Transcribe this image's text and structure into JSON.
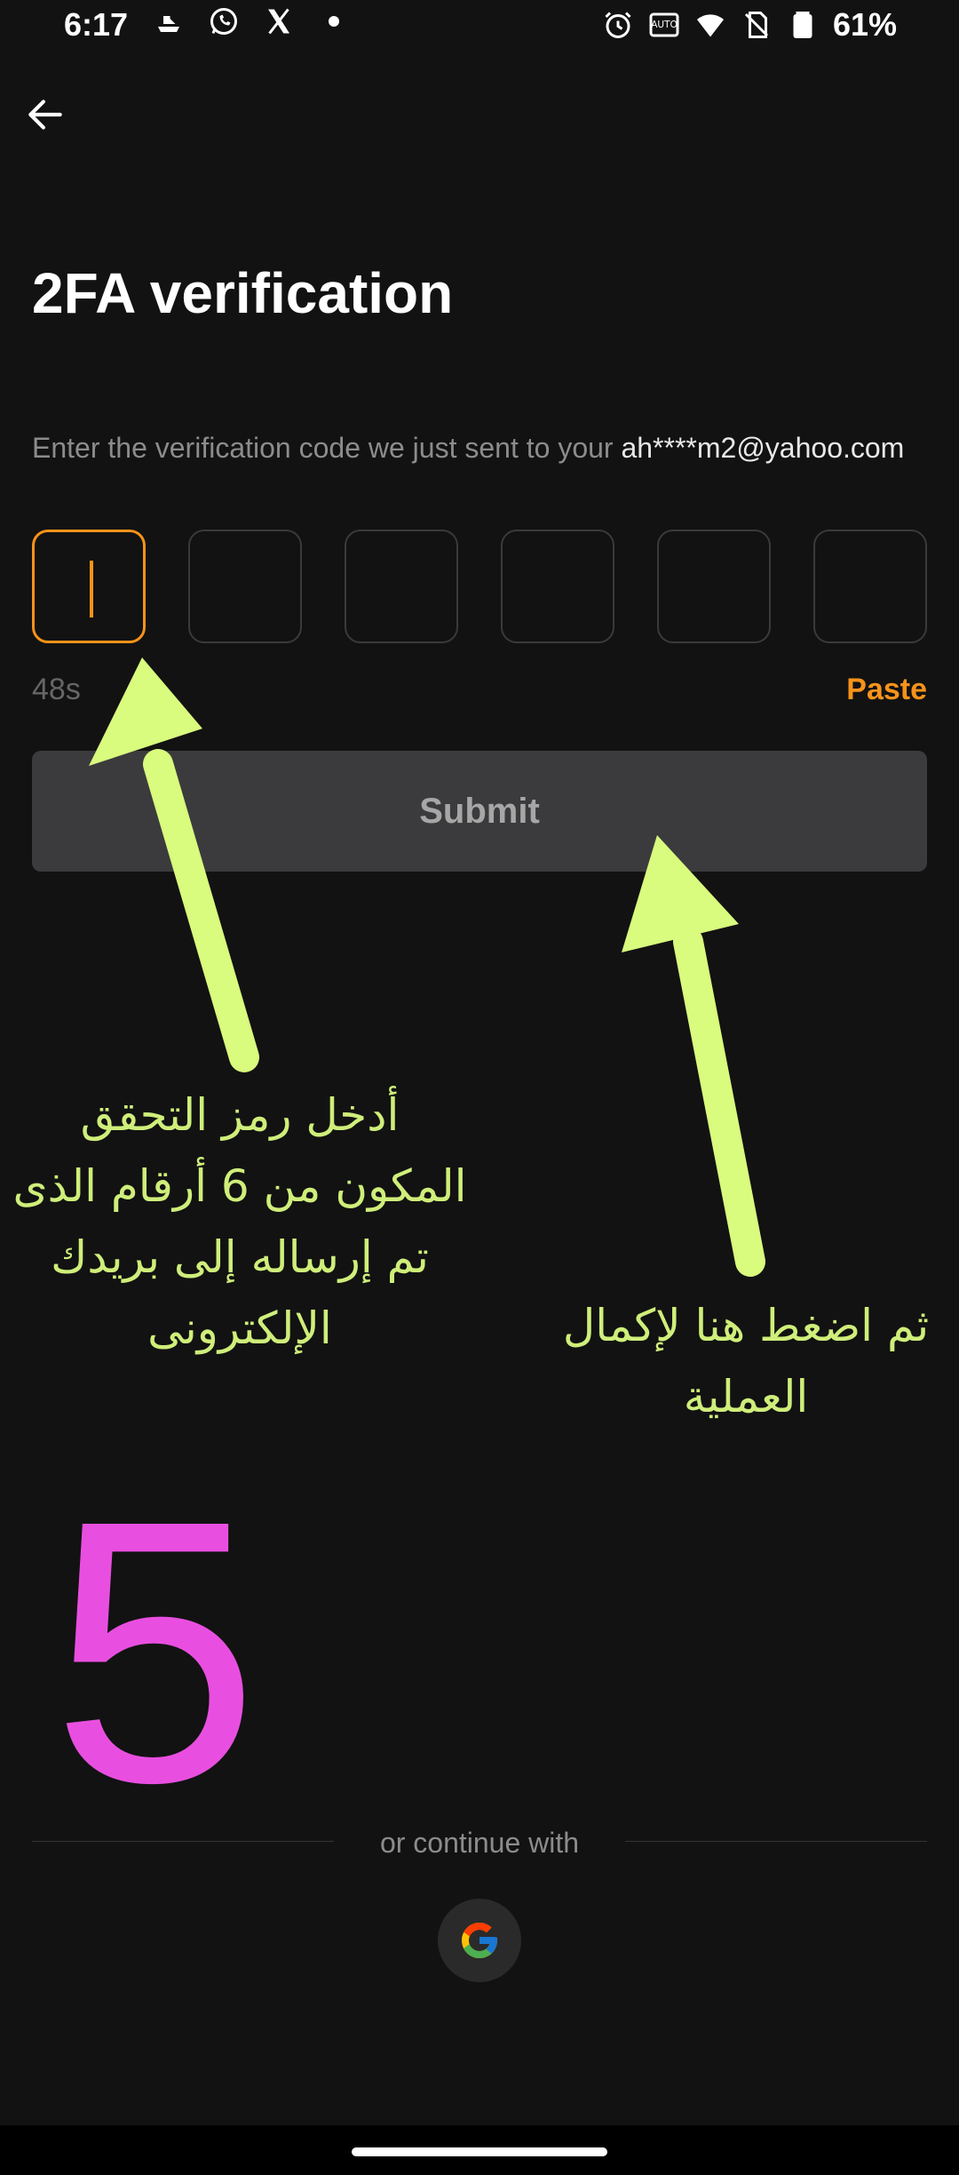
{
  "status_bar": {
    "time": "6:17",
    "battery": "61%",
    "left_icons": [
      "boat-icon",
      "whatsapp-icon",
      "x-icon",
      "dot-icon"
    ],
    "right_icons": [
      "alarm-icon",
      "auto-hz-icon",
      "wifi-6-icon",
      "no-sim-icon",
      "battery-icon"
    ]
  },
  "header": {
    "back_icon": "arrow-left-icon",
    "title": "2FA verification"
  },
  "verification": {
    "instruction_prefix": "Enter the verification code we just sent to your ",
    "email": "ah****m2@yahoo.com",
    "code_length": 6,
    "code_values": [
      "",
      "",
      "",
      "",
      "",
      ""
    ],
    "timer": "48s",
    "paste_label": "Paste",
    "submit_label": "Submit"
  },
  "annotations": {
    "left_text": "أدخل رمز التحقق\nالمكون من 6 أرقام الذى\nتم إرساله إلى بريدك\nالإلكترونى",
    "right_text": "ثم اضغط هنا لإكمال\nالعملية",
    "step_number": "5",
    "arrow_color": "#d9fb7e",
    "step_color": "#e84fe0"
  },
  "social": {
    "divider_text": "or continue with",
    "google_icon": "google-icon"
  },
  "colors": {
    "background": "#121212",
    "accent": "#f7931a",
    "submit_bg": "#3b3b3d"
  }
}
